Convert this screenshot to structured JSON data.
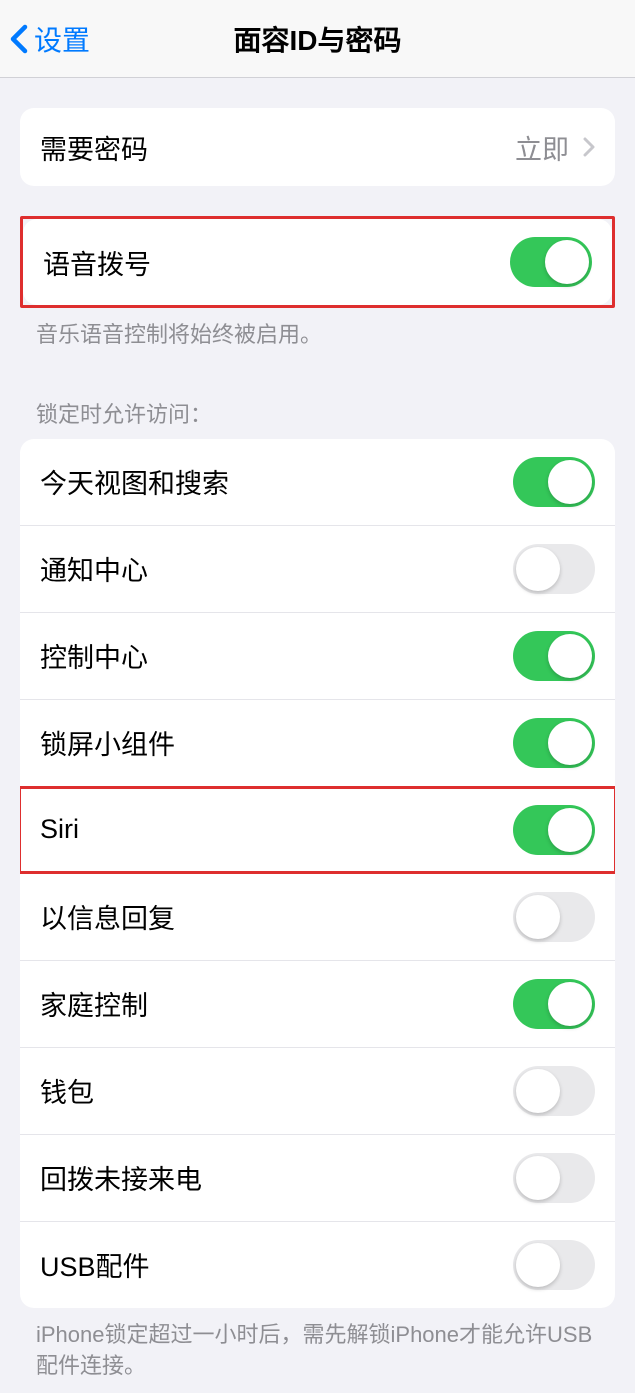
{
  "nav": {
    "back_label": "设置",
    "title": "面容ID与密码"
  },
  "passcode_section": {
    "require_passcode_label": "需要密码",
    "require_passcode_value": "立即"
  },
  "voice_dial": {
    "label": "语音拨号",
    "enabled": true,
    "footer": "音乐语音控制将始终被启用。"
  },
  "lock_access": {
    "header": "锁定时允许访问：",
    "items": [
      {
        "label": "今天视图和搜索",
        "enabled": true
      },
      {
        "label": "通知中心",
        "enabled": false
      },
      {
        "label": "控制中心",
        "enabled": true
      },
      {
        "label": "锁屏小组件",
        "enabled": true
      },
      {
        "label": "Siri",
        "enabled": true
      },
      {
        "label": "以信息回复",
        "enabled": false
      },
      {
        "label": "家庭控制",
        "enabled": true
      },
      {
        "label": "钱包",
        "enabled": false
      },
      {
        "label": "回拨未接来电",
        "enabled": false
      },
      {
        "label": "USB配件",
        "enabled": false
      }
    ],
    "footer": "iPhone锁定超过一小时后，需先解锁iPhone才能允许USB配件连接。"
  }
}
